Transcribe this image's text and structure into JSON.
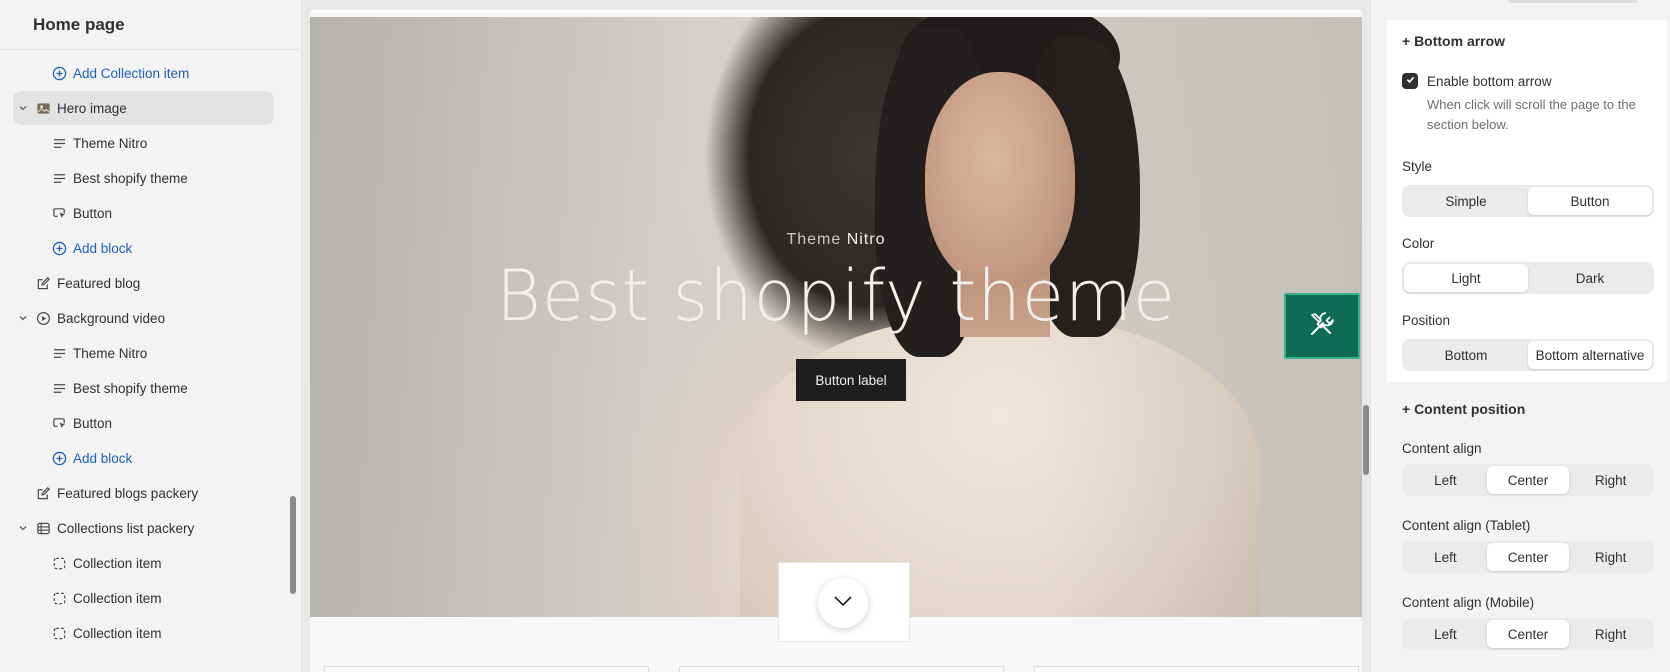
{
  "sidebar": {
    "title": "Home page",
    "items": [
      {
        "label": "Add Collection item"
      },
      {
        "label": "Hero image"
      },
      {
        "label": "Theme Nitro"
      },
      {
        "label": "Best shopify theme"
      },
      {
        "label": "Button"
      },
      {
        "label": "Add block"
      },
      {
        "label": "Featured blog"
      },
      {
        "label": "Background video"
      },
      {
        "label": "Theme Nitro"
      },
      {
        "label": "Best shopify theme"
      },
      {
        "label": "Button"
      },
      {
        "label": "Add block"
      },
      {
        "label": "Featured blogs packery"
      },
      {
        "label": "Collections list packery"
      },
      {
        "label": "Collection item"
      },
      {
        "label": "Collection item"
      },
      {
        "label": "Collection item"
      }
    ]
  },
  "preview": {
    "subtitle_dim": "Theme",
    "subtitle_bright": "Nitro",
    "title": "Best shopify theme",
    "button_label": "Button label"
  },
  "settings": {
    "bottom_arrow": {
      "title": "+ Bottom arrow",
      "enable_label": "Enable bottom arrow",
      "enable_checked": true,
      "help": "When click will scroll the page to the section below.",
      "style_label": "Style",
      "style_options": [
        "Simple",
        "Button"
      ],
      "style_selected": "Button",
      "color_label": "Color",
      "color_options": [
        "Light",
        "Dark"
      ],
      "color_selected": "Light",
      "position_label": "Position",
      "position_options": [
        "Bottom",
        "Bottom alternative"
      ],
      "position_selected": "Bottom alternative"
    },
    "content_position": {
      "title": "+ Content position",
      "align_label": "Content align",
      "align_tablet_label": "Content align (Tablet)",
      "align_mobile_label": "Content align (Mobile)",
      "align_options": [
        "Left",
        "Center",
        "Right"
      ],
      "align_selected": "Center"
    }
  },
  "colors": {
    "link": "#1f5fb5",
    "tool_button": "#0e6b54",
    "tool_button_border": "#39b18d"
  }
}
